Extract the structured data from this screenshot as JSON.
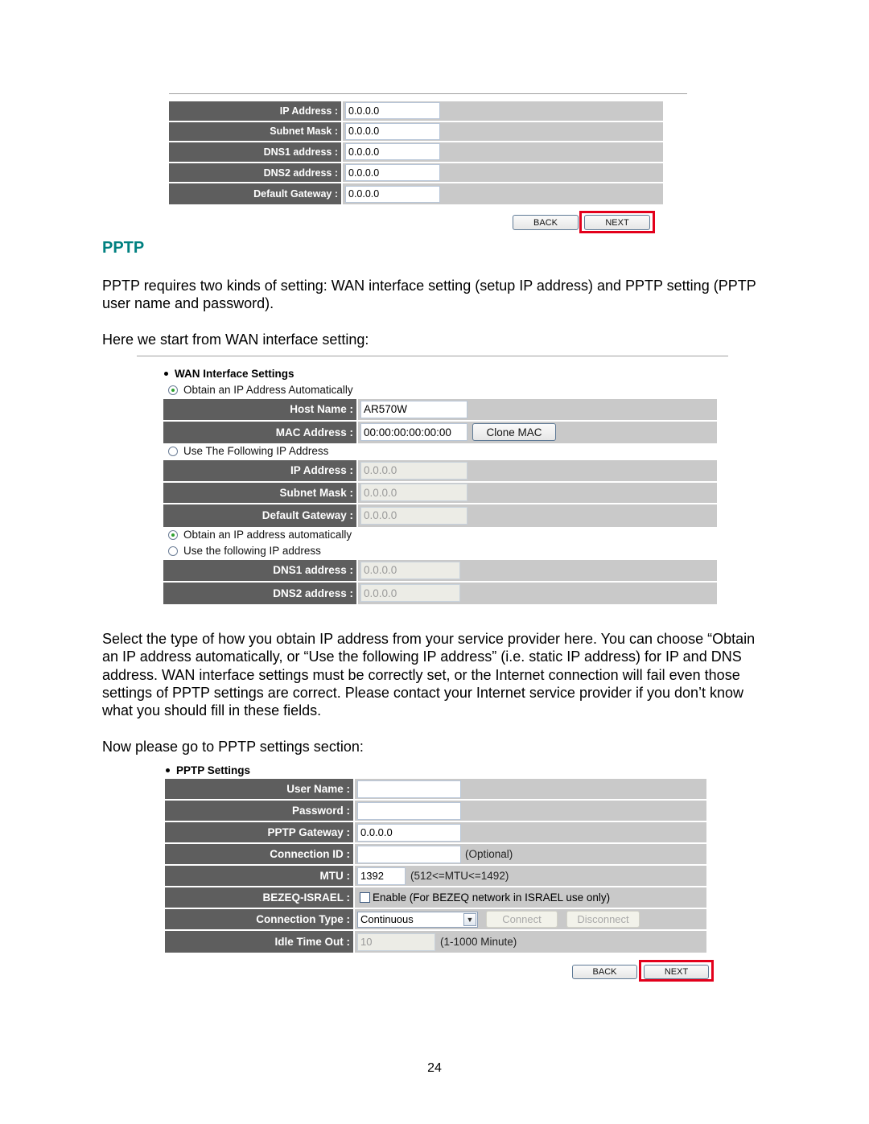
{
  "top_form": {
    "rows": [
      {
        "label": "IP Address :",
        "value": "0.0.0.0"
      },
      {
        "label": "Subnet Mask :",
        "value": "0.0.0.0"
      },
      {
        "label": "DNS1 address :",
        "value": "0.0.0.0"
      },
      {
        "label": "DNS2 address :",
        "value": "0.0.0.0"
      },
      {
        "label": "Default Gateway :",
        "value": "0.0.0.0"
      }
    ],
    "back_label": "BACK",
    "next_label": "NEXT"
  },
  "heading": "PPTP",
  "paragraphs": {
    "intro": "PPTP requires two kinds of setting: WAN interface setting (setup IP address) and PPTP setting (PPTP user name and password).",
    "wan_start": "Here we start from WAN interface setting:",
    "explain": "Select the type of how you obtain IP address from your service provider here. You can choose “Obtain an IP address automatically, or “Use the following IP address” (i.e. static IP address) for IP and DNS address. WAN interface settings must be correctly set, or the Internet connection will fail even those settings of PPTP settings are correct. Please contact your Internet service provider if you don’t know what you should fill in these fields.",
    "pptp_go": "Now please go to PPTP settings section:"
  },
  "wan_form": {
    "title": "WAN Interface Settings",
    "radio_auto": "Obtain an IP Address Automatically",
    "host_name_label": "Host Name :",
    "host_name_value": "AR570W",
    "mac_label": "MAC Address :",
    "mac_value": "00:00:00:00:00:00",
    "clone_mac_label": "Clone MAC",
    "radio_static": "Use The Following IP Address",
    "ip_label": "IP Address :",
    "ip_value": "0.0.0.0",
    "subnet_label": "Subnet Mask :",
    "subnet_value": "0.0.0.0",
    "gateway_label": "Default Gateway :",
    "gateway_value": "0.0.0.0",
    "dns_radio_auto": "Obtain an IP address automatically",
    "dns_radio_static": "Use the following IP address",
    "dns1_label": "DNS1 address :",
    "dns1_value": "0.0.0.0",
    "dns2_label": "DNS2 address :",
    "dns2_value": "0.0.0.0"
  },
  "pptp_form": {
    "title": "PPTP Settings",
    "user_label": "User Name :",
    "user_value": "",
    "password_label": "Password :",
    "password_value": "",
    "gateway_label": "PPTP Gateway :",
    "gateway_value": "0.0.0.0",
    "conn_id_label": "Connection ID :",
    "conn_id_value": "",
    "conn_id_hint": "(Optional)",
    "mtu_label": "MTU :",
    "mtu_value": "1392",
    "mtu_hint": "(512<=MTU<=1492)",
    "bezeq_label": "BEZEQ-ISRAEL :",
    "bezeq_checkbox_label": "Enable (For BEZEQ network in ISRAEL use only)",
    "conn_type_label": "Connection Type :",
    "conn_type_value": "Continuous",
    "connect_label": "Connect",
    "disconnect_label": "Disconnect",
    "idle_label": "Idle Time Out :",
    "idle_value": "10",
    "idle_hint": "(1-1000 Minute)",
    "back_label": "BACK",
    "next_label": "NEXT"
  },
  "page_number": "24"
}
